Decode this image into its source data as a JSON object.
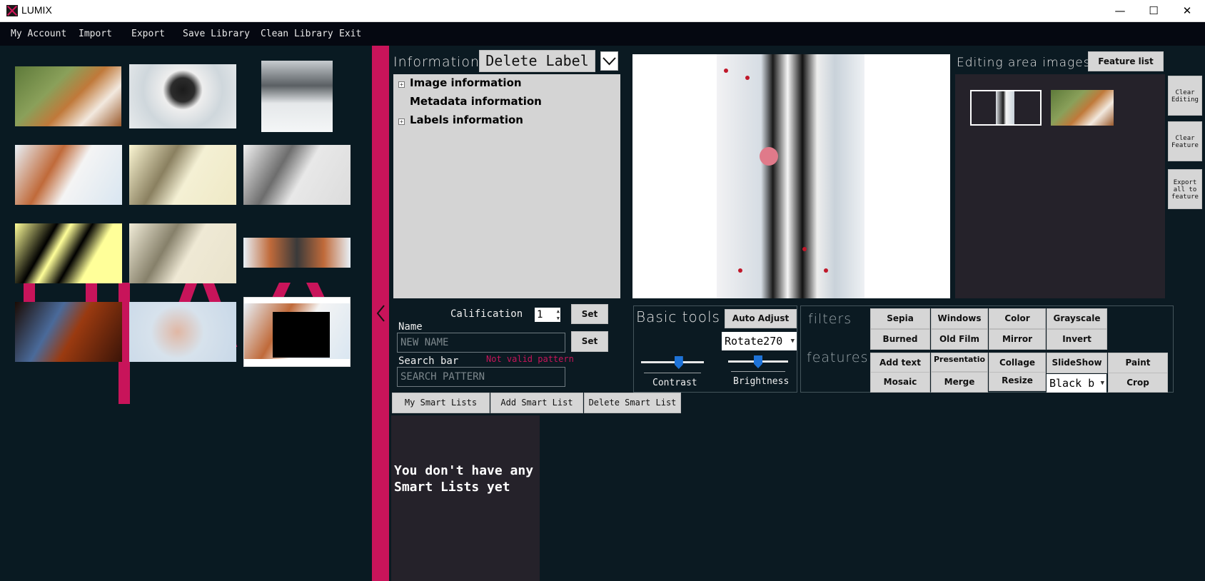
{
  "window": {
    "title": "LUMIX",
    "minimize_glyph": "—",
    "maximize_glyph": "☐",
    "close_glyph": "✕"
  },
  "menu": [
    "My Account",
    "Import",
    "Export",
    "Save Library",
    "Clean Library",
    "Exit"
  ],
  "information": {
    "heading": "Information",
    "delete_label": "Delete Label",
    "tree": [
      {
        "label": "Image information",
        "expandable": true
      },
      {
        "label": "Metadata information",
        "expandable": false
      },
      {
        "label": "Labels information",
        "expandable": true
      }
    ]
  },
  "editing_area": {
    "heading": "Editing area images",
    "feature_list_button": "Feature list",
    "side_buttons": [
      "Clear Editing",
      "Clear Feature",
      "Export all to feature"
    ]
  },
  "labels_form": {
    "calification_label": "Calification",
    "calification_value": "1",
    "set_label": "Set",
    "name_label": "Name",
    "name_placeholder": "NEW NAME",
    "search_label": "Search bar",
    "search_error": "Not valid pattern",
    "search_placeholder": "SEARCH PATTERN"
  },
  "basic_tools": {
    "heading": "Basic tools",
    "auto_adjust": "Auto Adjust",
    "rotate_selected": "Rotate270",
    "contrast_label": "Contrast",
    "contrast_value": 0.6,
    "brightness_label": "Brightness",
    "brightness_value": 0.5
  },
  "filters": {
    "heading": "filters",
    "buttons": [
      "Sepia",
      "Windows",
      "Color",
      "Grayscale",
      "Burned",
      "Old Film",
      "Mirror",
      "Invert"
    ]
  },
  "features": {
    "heading": "features",
    "buttons": [
      "Add text",
      "Presentatio",
      "Collage",
      "SlideShow",
      "Paint",
      "Mosaic",
      "Merge",
      "Resize",
      "Crop"
    ],
    "color_selected": "Black b"
  },
  "smart_lists": {
    "tabs": [
      "My Smart Lists",
      "Add Smart List",
      "Delete Smart List"
    ],
    "empty_message": "You don't have any Smart Lists yet"
  },
  "colors": {
    "accent": "#c8145a",
    "background": "#0b1a22",
    "menubar": "#050811",
    "panel_gray": "#d4d4d4",
    "dark_panel": "#25222a"
  },
  "icons": {
    "collapse": "chevron-left-icon",
    "dropdown": "chevron-down-icon",
    "tree_expand": "plus-box-icon"
  }
}
